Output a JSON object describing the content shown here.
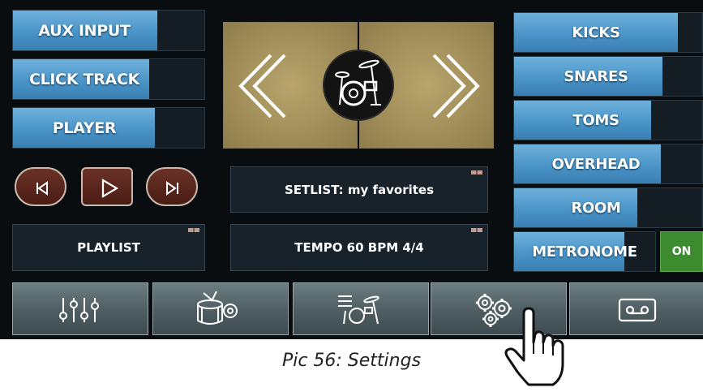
{
  "left_channels": [
    {
      "label": "AUX INPUT",
      "level": 0.73
    },
    {
      "label": "CLICK TRACK",
      "level": 0.69
    },
    {
      "label": "PLAYER",
      "level": 0.72
    }
  ],
  "transport": {
    "prev_icon": "skip-back-icon",
    "play_icon": "play-icon",
    "next_icon": "skip-forward-icon"
  },
  "playlist_label": "PLAYLIST",
  "setlist_label": "SETLIST: my favorites",
  "tempo_label": "TEMPO 60 BPM 4/4",
  "kit_selector": {
    "prev_icon": "chevron-left-icon",
    "next_icon": "chevron-right-icon",
    "kit_icon": "drum-kit-icon"
  },
  "right_channels": [
    {
      "label": "KICKS",
      "level": 0.83
    },
    {
      "label": "SNARES",
      "level": 0.78
    },
    {
      "label": "TOMS",
      "level": 0.72
    },
    {
      "label": "OVERHEAD",
      "level": 0.76
    },
    {
      "label": "ROOM",
      "level": 0.66
    }
  ],
  "metronome": {
    "label": "METRONOME",
    "state": "ON",
    "level": 0.77
  },
  "bottom_nav": [
    {
      "name": "mixer",
      "icon": "sliders-icon"
    },
    {
      "name": "drum-settings",
      "icon": "drum-gear-icon"
    },
    {
      "name": "kit-edit",
      "icon": "drum-kit-list-icon"
    },
    {
      "name": "settings",
      "icon": "gears-icon"
    },
    {
      "name": "recorder",
      "icon": "cassette-icon"
    }
  ],
  "caption": "Pic 56: Settings",
  "colors": {
    "accent_blue": "#4a94c8",
    "on_green": "#3c8b2f",
    "kit_gold": "#a08d58",
    "transport_red": "#5a241a"
  }
}
